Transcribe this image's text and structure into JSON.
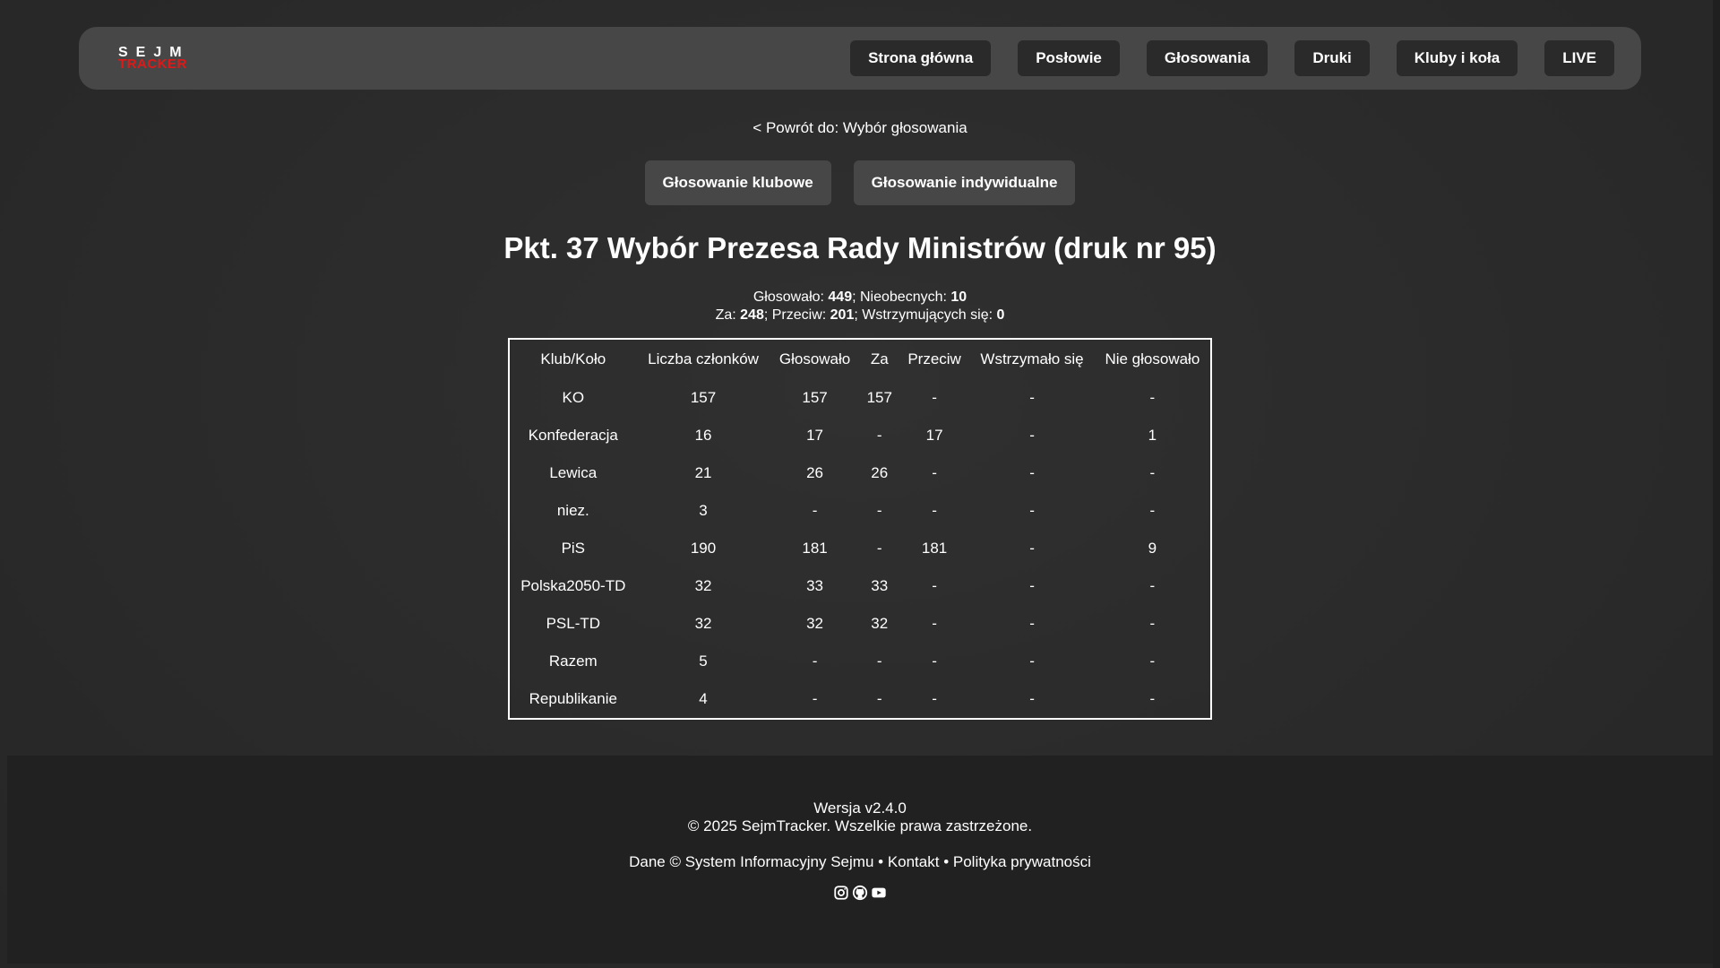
{
  "logo": {
    "top": "SEJM",
    "bottom": "TRACKER"
  },
  "nav": [
    {
      "label": "Strona główna"
    },
    {
      "label": "Posłowie"
    },
    {
      "label": "Głosowania"
    },
    {
      "label": "Druki"
    },
    {
      "label": "Kluby i koła"
    },
    {
      "label": "LIVE"
    }
  ],
  "back_link": "< Powrót do: Wybór głosowania",
  "modes": {
    "club": "Głosowanie klubowe",
    "individual": "Głosowanie indywidualne"
  },
  "title": "Pkt. 37 Wybór Prezesa Rady Ministrów (druk nr 95)",
  "summary": {
    "voted_label": "Głosowało: ",
    "voted": "449",
    "absent_label": "; Nieobecnych: ",
    "absent": "10",
    "for_label": "Za: ",
    "for": "248",
    "against_label": "; Przeciw: ",
    "against": "201",
    "abstain_label": "; Wstrzymujących się: ",
    "abstain": "0"
  },
  "table": {
    "headers": [
      "Klub/Koło",
      "Liczba członków",
      "Głosowało",
      "Za",
      "Przeciw",
      "Wstrzymało się",
      "Nie głosowało"
    ],
    "rows": [
      [
        "KO",
        "157",
        "157",
        "157",
        "-",
        "-",
        "-"
      ],
      [
        "Konfederacja",
        "16",
        "17",
        "-",
        "17",
        "-",
        "1"
      ],
      [
        "Lewica",
        "21",
        "26",
        "26",
        "-",
        "-",
        "-"
      ],
      [
        "niez.",
        "3",
        "-",
        "-",
        "-",
        "-",
        "-"
      ],
      [
        "PiS",
        "190",
        "181",
        "-",
        "181",
        "-",
        "9"
      ],
      [
        "Polska2050-TD",
        "32",
        "33",
        "33",
        "-",
        "-",
        "-"
      ],
      [
        "PSL-TD",
        "32",
        "32",
        "32",
        "-",
        "-",
        "-"
      ],
      [
        "Razem",
        "5",
        "-",
        "-",
        "-",
        "-",
        "-"
      ],
      [
        "Republikanie",
        "4",
        "-",
        "-",
        "-",
        "-",
        "-"
      ]
    ]
  },
  "footer": {
    "version": "Wersja v2.4.0",
    "copyright": "© 2025 SejmTracker. Wszelkie prawa zastrzeżone.",
    "data_source": "Dane © System Informacyjny Sejmu",
    "sep": " • ",
    "contact": "Kontakt",
    "privacy": "Polityka prywatności",
    "socials": [
      "instagram-icon",
      "github-icon",
      "youtube-icon"
    ]
  },
  "colors": {
    "bg": "#2b2b2b",
    "header": "#474747",
    "nav_btn": "#2a2a2a",
    "accent_red": "#e01818",
    "footer": "#212121"
  }
}
